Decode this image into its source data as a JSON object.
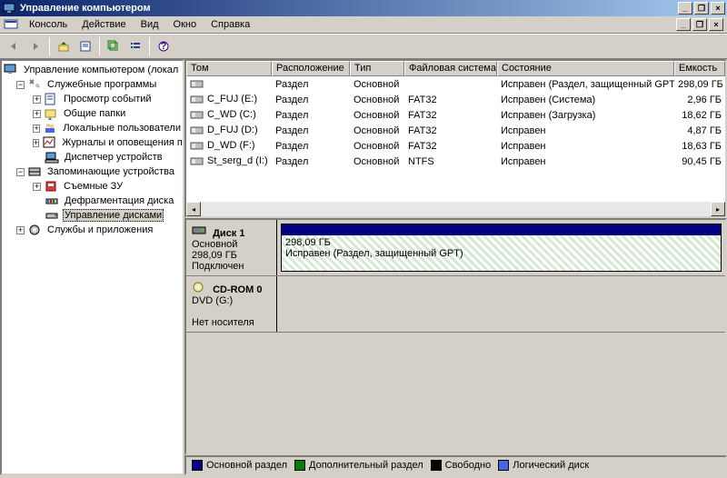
{
  "title": "Управление компьютером",
  "menu": {
    "icon": "monitor-icon",
    "items": [
      "Консоль",
      "Действие",
      "Вид",
      "Окно",
      "Справка"
    ]
  },
  "tree": {
    "root": "Управление компьютером (локал",
    "system_tools": "Служебные программы",
    "event_viewer": "Просмотр событий",
    "shared": "Общие папки",
    "local_users": "Локальные пользователи",
    "perf_logs": "Журналы и оповещения пр",
    "devmgr": "Диспетчер устройств",
    "storage": "Запоминающие устройства",
    "removable": "Съемные ЗУ",
    "defrag": "Дефрагментация диска",
    "diskmgmt": "Управление дисками",
    "services": "Службы и приложения"
  },
  "columns": [
    "Том",
    "Расположение",
    "Тип",
    "Файловая система",
    "Состояние",
    "Емкость"
  ],
  "volumes": [
    {
      "name": "",
      "layout": "Раздел",
      "type": "Основной",
      "fs": "",
      "status": "Исправен (Раздел, защищенный GPT)",
      "cap": "298,09 ГБ"
    },
    {
      "name": "C_FUJ (E:)",
      "layout": "Раздел",
      "type": "Основной",
      "fs": "FAT32",
      "status": "Исправен (Система)",
      "cap": "2,96 ГБ"
    },
    {
      "name": "C_WD (C:)",
      "layout": "Раздел",
      "type": "Основной",
      "fs": "FAT32",
      "status": "Исправен (Загрузка)",
      "cap": "18,62 ГБ"
    },
    {
      "name": "D_FUJ (D:)",
      "layout": "Раздел",
      "type": "Основной",
      "fs": "FAT32",
      "status": "Исправен",
      "cap": "4,87 ГБ"
    },
    {
      "name": "D_WD (F:)",
      "layout": "Раздел",
      "type": "Основной",
      "fs": "FAT32",
      "status": "Исправен",
      "cap": "18,63 ГБ"
    },
    {
      "name": "St_serg_d (I:)",
      "layout": "Раздел",
      "type": "Основной",
      "fs": "NTFS",
      "status": "Исправен",
      "cap": "90,45 ГБ"
    }
  ],
  "disk1": {
    "name": "Диск 1",
    "type": "Основной",
    "size": "298,09 ГБ",
    "state": "Подключен",
    "part_size": "298,09 ГБ",
    "part_status": "Исправен (Раздел, защищенный GPT)"
  },
  "cdrom": {
    "name": "CD-ROM 0",
    "type": "DVD (G:)",
    "state": "Нет носителя"
  },
  "legend": {
    "primary": "Основной раздел",
    "extended": "Дополнительный раздел",
    "free": "Свободно",
    "logical": "Логический диск"
  },
  "colors": {
    "primary": "#000080",
    "extended": "#008000",
    "free": "#000000",
    "logical": "#4169e1"
  }
}
